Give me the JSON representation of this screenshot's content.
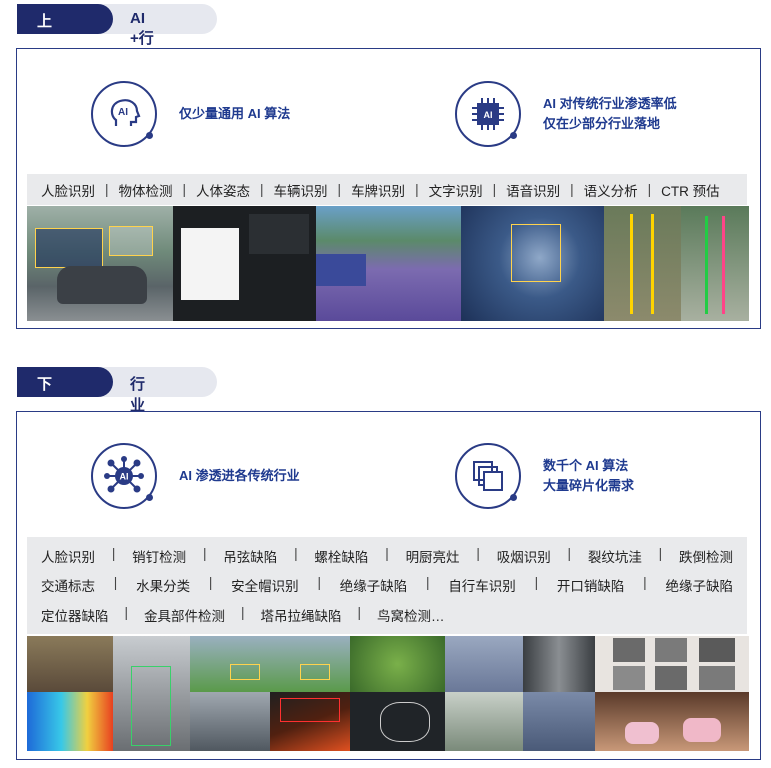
{
  "top": {
    "tab_label": "上半场",
    "tab_subtitle": "AI +行业",
    "features": [
      {
        "icon": "ai-head-icon",
        "lines": [
          "仅少量通用 AI 算法"
        ]
      },
      {
        "icon": "ai-chip-icon",
        "lines": [
          "AI 对传统行业渗透率低",
          "仅在少部分行业落地"
        ]
      }
    ],
    "categories": [
      "人脸识别",
      "物体检测",
      "人体姿态",
      "车辆识别",
      "车牌识别",
      "文字识别",
      "语音识别",
      "语义分析",
      "CTR 预估"
    ]
  },
  "bottom": {
    "tab_label": "下半场",
    "tab_subtitle": "行业 + AI",
    "features": [
      {
        "icon": "ai-network-icon",
        "lines": [
          "AI 渗透进各传统行业"
        ]
      },
      {
        "icon": "fragments-icon",
        "lines": [
          "数千个 AI 算法",
          "大量碎片化需求"
        ]
      }
    ],
    "category_rows": [
      [
        "人脸识别",
        "销钉检测",
        "吊弦缺陷",
        "螺栓缺陷",
        "明厨亮灶",
        "吸烟识别",
        "裂纹坑洼",
        "跌倒检测"
      ],
      [
        "交通标志",
        "水果分类",
        "安全帽识别",
        "绝缘子缺陷",
        "自行车识别",
        "开口销缺陷",
        "绝缘子缺陷"
      ],
      [
        "定位器缺陷",
        "金具部件检测",
        "塔吊拉绳缺陷",
        "鸟窝检测…"
      ]
    ]
  },
  "icons": {
    "ai_label": "AI"
  },
  "colors": {
    "navy": "#1f2a6b",
    "accent": "#2a3b85",
    "gray_bar": "#e9eaec"
  }
}
